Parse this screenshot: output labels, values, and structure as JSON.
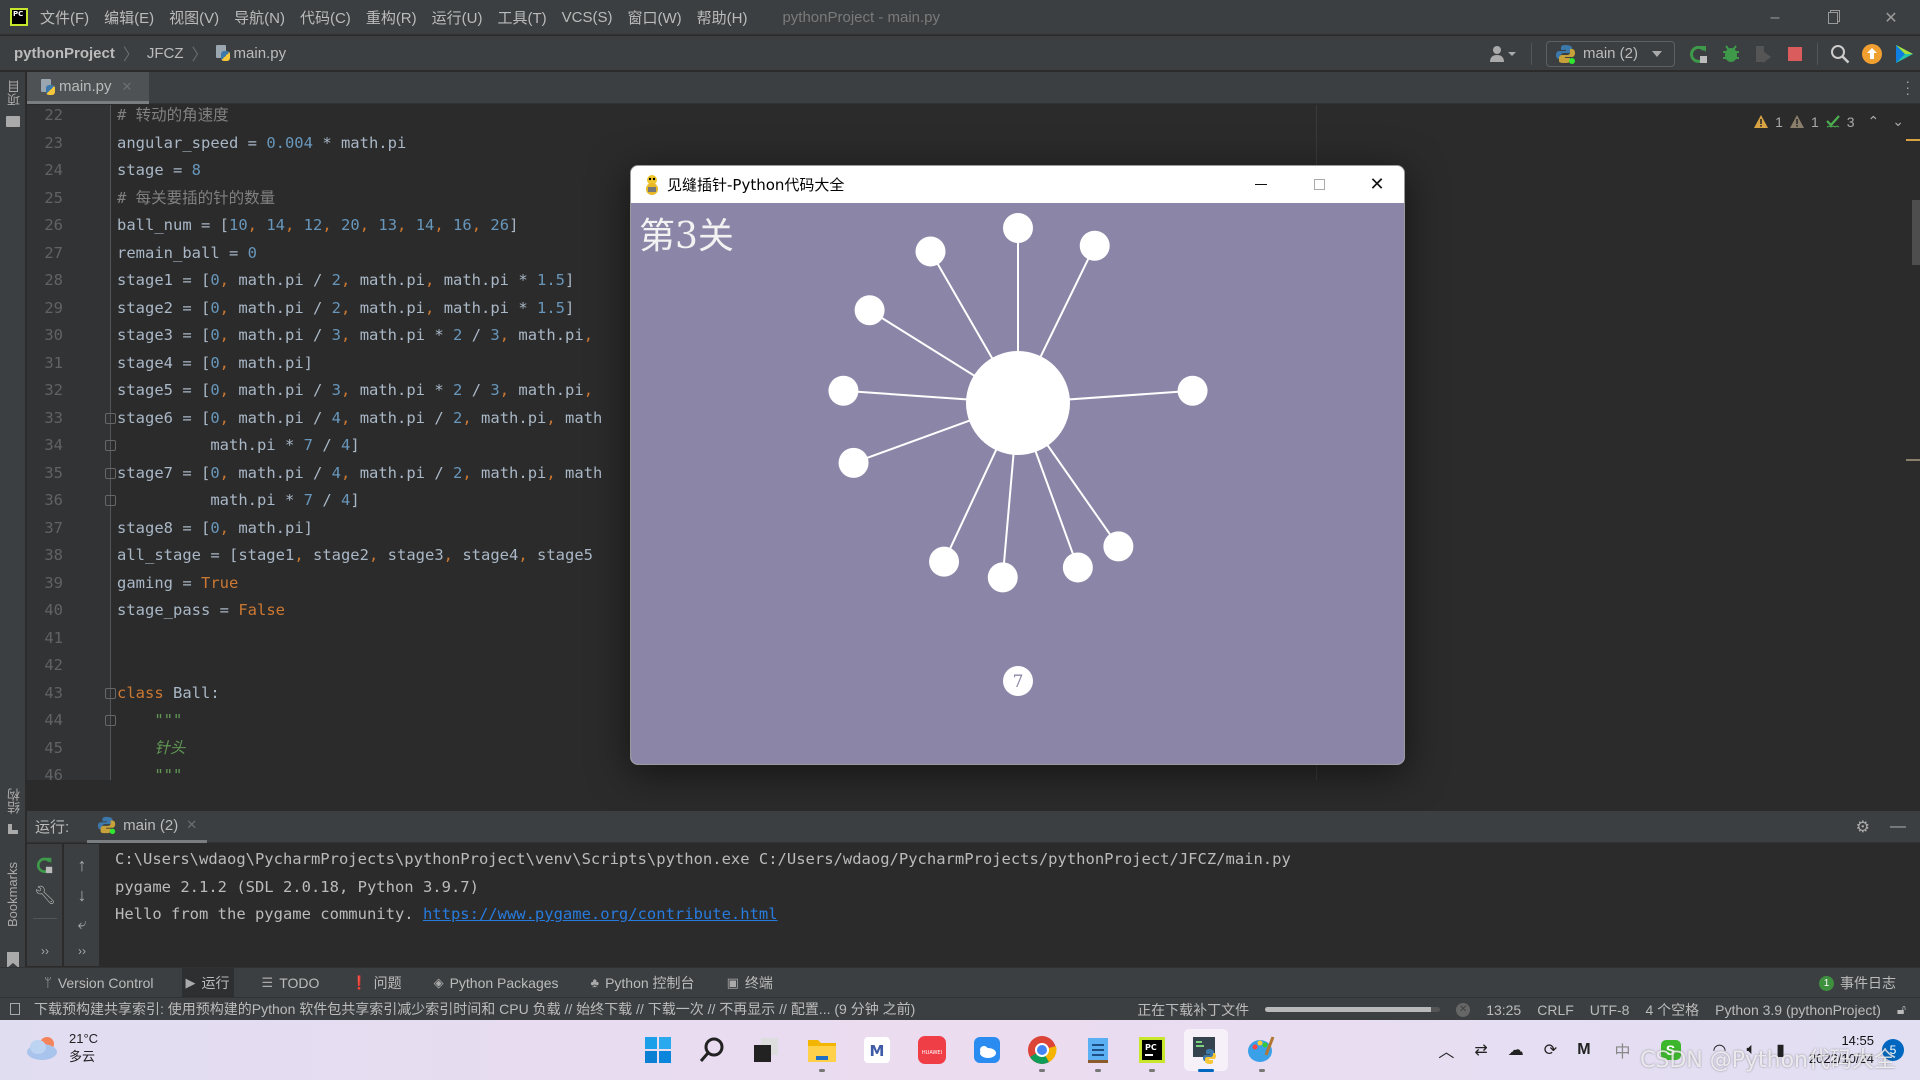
{
  "app": {
    "menu": [
      "文件(F)",
      "编辑(E)",
      "视图(V)",
      "导航(N)",
      "代码(C)",
      "重构(R)",
      "运行(U)",
      "工具(T)",
      "VCS(S)",
      "窗口(W)",
      "帮助(H)"
    ],
    "window_title": "pythonProject - main.py",
    "logo_text": "PC"
  },
  "breadcrumb": {
    "project": "pythonProject",
    "folder": "JFCZ",
    "file": "main.py"
  },
  "toolbar": {
    "run_config": "main (2)",
    "icons": [
      "user-icon",
      "rerun-icon",
      "debug-icon",
      "coverage-icon",
      "stop-icon",
      "search-icon",
      "update-icon",
      "toolbox-icon"
    ]
  },
  "sidebar": {
    "project_label": "项目",
    "structure_label": "结构",
    "bookmarks_label": "Bookmarks"
  },
  "editor": {
    "tab": "main.py",
    "inspections": {
      "warnings": "1",
      "weak_warnings": "1",
      "typos": "3"
    },
    "lines": [
      {
        "n": "22",
        "tokens": [
          [
            "cm",
            "# 转动的角速度"
          ]
        ]
      },
      {
        "n": "23",
        "tokens": [
          [
            "op",
            "angular_speed = "
          ],
          [
            "num",
            "0.004"
          ],
          [
            "op",
            " * math.pi"
          ]
        ]
      },
      {
        "n": "24",
        "tokens": [
          [
            "op",
            "stage = "
          ],
          [
            "num",
            "8"
          ]
        ]
      },
      {
        "n": "25",
        "tokens": [
          [
            "cm",
            "# 每关要插的针的数量"
          ]
        ]
      },
      {
        "n": "26",
        "tokens": [
          [
            "op",
            "ball_num = ["
          ],
          [
            "num",
            "10"
          ],
          [
            "kw",
            ", "
          ],
          [
            "num",
            "14"
          ],
          [
            "kw",
            ", "
          ],
          [
            "num",
            "12"
          ],
          [
            "kw",
            ", "
          ],
          [
            "num",
            "20"
          ],
          [
            "kw",
            ", "
          ],
          [
            "num",
            "13"
          ],
          [
            "kw",
            ", "
          ],
          [
            "num",
            "14"
          ],
          [
            "kw",
            ", "
          ],
          [
            "num",
            "16"
          ],
          [
            "kw",
            ", "
          ],
          [
            "num",
            "26"
          ],
          [
            "op",
            "]"
          ]
        ]
      },
      {
        "n": "27",
        "tokens": [
          [
            "op",
            "remain_ball = "
          ],
          [
            "num",
            "0"
          ]
        ]
      },
      {
        "n": "28",
        "tokens": [
          [
            "op",
            "stage1 = ["
          ],
          [
            "num",
            "0"
          ],
          [
            "kw",
            ", "
          ],
          [
            "op",
            "math.pi / "
          ],
          [
            "num",
            "2"
          ],
          [
            "kw",
            ", "
          ],
          [
            "op",
            "math.pi"
          ],
          [
            "kw",
            ", "
          ],
          [
            "op",
            "math.pi * "
          ],
          [
            "num",
            "1.5"
          ],
          [
            "op",
            "]"
          ]
        ]
      },
      {
        "n": "29",
        "tokens": [
          [
            "op",
            "stage2 = ["
          ],
          [
            "num",
            "0"
          ],
          [
            "kw",
            ", "
          ],
          [
            "op",
            "math.pi / "
          ],
          [
            "num",
            "2"
          ],
          [
            "kw",
            ", "
          ],
          [
            "op",
            "math.pi"
          ],
          [
            "kw",
            ", "
          ],
          [
            "op",
            "math.pi * "
          ],
          [
            "num",
            "1.5"
          ],
          [
            "op",
            "]"
          ]
        ]
      },
      {
        "n": "30",
        "tokens": [
          [
            "op",
            "stage3 = ["
          ],
          [
            "num",
            "0"
          ],
          [
            "kw",
            ", "
          ],
          [
            "op",
            "math.pi / "
          ],
          [
            "num",
            "3"
          ],
          [
            "kw",
            ", "
          ],
          [
            "op",
            "math.pi * "
          ],
          [
            "num",
            "2"
          ],
          [
            "op",
            " / "
          ],
          [
            "num",
            "3"
          ],
          [
            "kw",
            ", "
          ],
          [
            "op",
            "math.pi"
          ],
          [
            "kw",
            ","
          ]
        ]
      },
      {
        "n": "31",
        "tokens": [
          [
            "op",
            "stage4 = ["
          ],
          [
            "num",
            "0"
          ],
          [
            "kw",
            ", "
          ],
          [
            "op",
            "math.pi]"
          ]
        ]
      },
      {
        "n": "32",
        "tokens": [
          [
            "op",
            "stage5 = ["
          ],
          [
            "num",
            "0"
          ],
          [
            "kw",
            ", "
          ],
          [
            "op",
            "math.pi / "
          ],
          [
            "num",
            "3"
          ],
          [
            "kw",
            ", "
          ],
          [
            "op",
            "math.pi * "
          ],
          [
            "num",
            "2"
          ],
          [
            "op",
            " / "
          ],
          [
            "num",
            "3"
          ],
          [
            "kw",
            ", "
          ],
          [
            "op",
            "math.pi"
          ],
          [
            "kw",
            ","
          ]
        ]
      },
      {
        "n": "33",
        "fold": true,
        "tokens": [
          [
            "op",
            "stage6 = ["
          ],
          [
            "num",
            "0"
          ],
          [
            "kw",
            ", "
          ],
          [
            "op",
            "math.pi / "
          ],
          [
            "num",
            "4"
          ],
          [
            "kw",
            ", "
          ],
          [
            "op",
            "math.pi / "
          ],
          [
            "num",
            "2"
          ],
          [
            "kw",
            ", "
          ],
          [
            "op",
            "math.pi"
          ],
          [
            "kw",
            ", "
          ],
          [
            "op",
            "math"
          ]
        ]
      },
      {
        "n": "34",
        "fold": true,
        "tokens": [
          [
            "op",
            "          math.pi * "
          ],
          [
            "num",
            "7"
          ],
          [
            "op",
            " / "
          ],
          [
            "num",
            "4"
          ],
          [
            "op",
            "]"
          ]
        ]
      },
      {
        "n": "35",
        "fold": true,
        "tokens": [
          [
            "op",
            "stage7 = ["
          ],
          [
            "num",
            "0"
          ],
          [
            "kw",
            ", "
          ],
          [
            "op",
            "math.pi / "
          ],
          [
            "num",
            "4"
          ],
          [
            "kw",
            ", "
          ],
          [
            "op",
            "math.pi / "
          ],
          [
            "num",
            "2"
          ],
          [
            "kw",
            ", "
          ],
          [
            "op",
            "math.pi"
          ],
          [
            "kw",
            ", "
          ],
          [
            "op",
            "math"
          ]
        ]
      },
      {
        "n": "36",
        "fold": true,
        "tokens": [
          [
            "op",
            "          math.pi * "
          ],
          [
            "num",
            "7"
          ],
          [
            "op",
            " / "
          ],
          [
            "num",
            "4"
          ],
          [
            "op",
            "]"
          ]
        ]
      },
      {
        "n": "37",
        "tokens": [
          [
            "op",
            "stage8 = ["
          ],
          [
            "num",
            "0"
          ],
          [
            "kw",
            ", "
          ],
          [
            "op",
            "math.pi]"
          ]
        ]
      },
      {
        "n": "38",
        "tokens": [
          [
            "op",
            "all_stage = [stage1"
          ],
          [
            "kw",
            ", "
          ],
          [
            "op",
            "stage2"
          ],
          [
            "kw",
            ", "
          ],
          [
            "op",
            "stage3"
          ],
          [
            "kw",
            ", "
          ],
          [
            "op",
            "stage4"
          ],
          [
            "kw",
            ", "
          ],
          [
            "op",
            "stage5"
          ]
        ]
      },
      {
        "n": "39",
        "tokens": [
          [
            "op",
            "gaming = "
          ],
          [
            "kw",
            "True"
          ]
        ]
      },
      {
        "n": "40",
        "tokens": [
          [
            "op",
            "stage_pass = "
          ],
          [
            "kw",
            "False"
          ]
        ]
      },
      {
        "n": "41",
        "tokens": []
      },
      {
        "n": "42",
        "tokens": []
      },
      {
        "n": "43",
        "fold": true,
        "tokens": [
          [
            "kw",
            "class "
          ],
          [
            "op",
            "Ball:"
          ]
        ]
      },
      {
        "n": "44",
        "fold": true,
        "tokens": [
          [
            "doc",
            "    \"\"\""
          ]
        ]
      },
      {
        "n": "45",
        "tokens": [
          [
            "doc",
            "    针头"
          ]
        ]
      },
      {
        "n": "46",
        "tokens": [
          [
            "doc",
            "    \"\"\""
          ]
        ]
      }
    ]
  },
  "game_window": {
    "title": "见缝插针-Python代码大全",
    "stage_label": "第3关",
    "remaining_balls": "7",
    "bg_color": "#8b86a7",
    "pin_angles_deg": [
      90,
      64,
      120,
      148,
      4,
      176,
      200,
      245,
      265,
      290,
      305
    ]
  },
  "run_panel": {
    "label": "运行:",
    "tab": "main (2)",
    "output": [
      "C:\\Users\\wdaog\\PycharmProjects\\pythonProject\\venv\\Scripts\\python.exe C:/Users/wdaog/PycharmProjects/pythonProject/JFCZ/main.py",
      "pygame 2.1.2 (SDL 2.0.18, Python 3.9.7)"
    ],
    "hello_text": "Hello from the pygame community. ",
    "hello_link": "https://www.pygame.org/contribute.html"
  },
  "bottom_tabs": [
    "Version Control",
    "运行",
    "TODO",
    "问题",
    "Python Packages",
    "Python 控制台",
    "终端"
  ],
  "event_log": {
    "count": "1",
    "label": "事件日志"
  },
  "status_bar": {
    "message": "下载预构建共享索引: 使用预构建的Python 软件包共享索引减少索引时间和 CPU 负载 // 始终下载 // 下载一次 // 不再显示 // 配置... (9 分钟 之前)",
    "task": "正在下载补丁文件",
    "progress": 0.95,
    "position": "13:25",
    "line_sep": "CRLF",
    "encoding": "UTF-8",
    "indent": "4 个空格",
    "interpreter": "Python 3.9 (pythonProject)"
  },
  "taskbar": {
    "weather_temp": "21°C",
    "weather_desc": "多云",
    "apps": [
      "start",
      "search",
      "task-view",
      "file-explorer",
      "app-m",
      "huawei-appgallery",
      "cloud-drive",
      "chrome",
      "notepad",
      "pycharm",
      "python",
      "paint"
    ],
    "ime": "中",
    "time": "14:55",
    "date": "2022/10/24",
    "notifications": "5"
  },
  "watermark": "CSDN @Python代码大全"
}
